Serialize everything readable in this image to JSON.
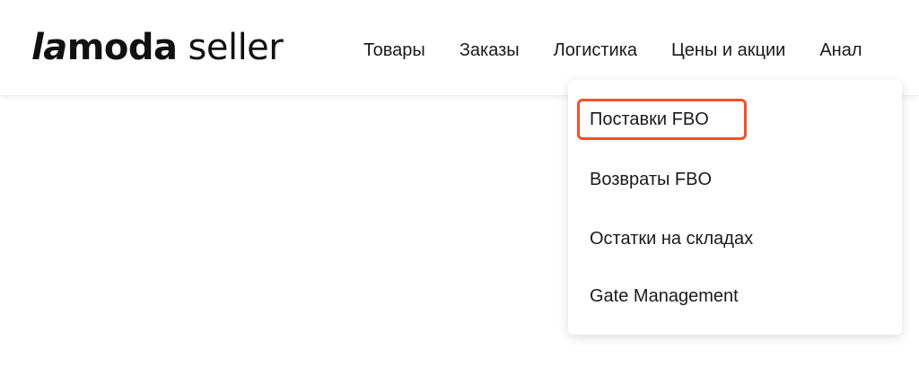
{
  "logo": {
    "brand_la": "la",
    "brand_moda": "moda",
    "suffix": "seller"
  },
  "nav": {
    "items": [
      {
        "label": "Товары"
      },
      {
        "label": "Заказы"
      },
      {
        "label": "Логистика"
      },
      {
        "label": "Цены и акции"
      },
      {
        "label": "Анал"
      }
    ]
  },
  "dropdown": {
    "items": [
      {
        "label": "Поставки FBO"
      },
      {
        "label": "Возвраты FBO"
      },
      {
        "label": "Остатки на складах"
      },
      {
        "label": "Gate Management"
      }
    ]
  },
  "colors": {
    "highlight": "#f0522a",
    "text": "#1a1a1a",
    "background": "#ffffff"
  }
}
